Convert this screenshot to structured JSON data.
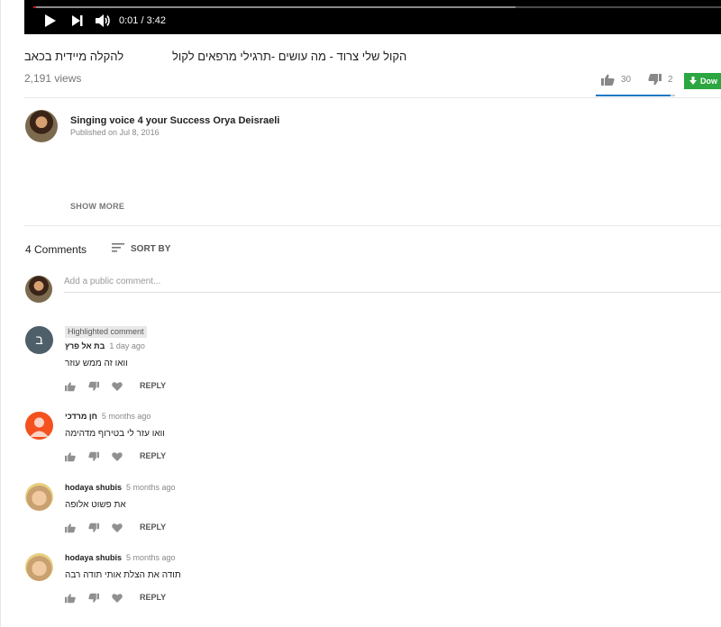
{
  "player": {
    "time": "0:01 / 3:42",
    "progress_fraction": 0.0045,
    "loaded_fraction": 0.7
  },
  "video": {
    "title_part_a": "להקלה מיידית בכאב",
    "title_part_b": "הקול שלי צרוד - מה עושים -תרגילי מרפאים לקול",
    "views": "2,191 views",
    "likes": "30",
    "dislikes": "2",
    "like_fraction": 0.9375,
    "download_label": "Dow"
  },
  "channel": {
    "name": "Singing voice 4 your Success Orya Deisraeli",
    "published": "Published on Jul 8, 2016",
    "show_more": "SHOW MORE"
  },
  "comments_header": {
    "count": "4 Comments",
    "sort_label": "SORT BY",
    "add_placeholder": "Add a public comment..."
  },
  "comments": [
    {
      "badge": "Highlighted comment",
      "avatar_letter": "ב",
      "avatar_color": "#4f5f6a",
      "author": "בת אל פרץ",
      "time": "1 day ago",
      "text": "וואו זה ממש עוזר",
      "reply": "REPLY"
    },
    {
      "badge": "",
      "avatar_letter": "",
      "avatar_color": "#f4511e",
      "author": "חן מרדכי",
      "time": "5 months ago",
      "text": "וואו עזר לי בטירוף מדהימה",
      "reply": "REPLY"
    },
    {
      "badge": "",
      "avatar_letter": "",
      "avatar_color": "#c9a070",
      "author": "hodaya shubis",
      "time": "5 months ago",
      "text": "את פשוט אלופה",
      "reply": "REPLY"
    },
    {
      "badge": "",
      "avatar_letter": "",
      "avatar_color": "#c9a070",
      "author": "hodaya shubis",
      "time": "5 months ago",
      "text": "תודה את הצלת אותי תודה רבה",
      "reply": "REPLY"
    }
  ]
}
